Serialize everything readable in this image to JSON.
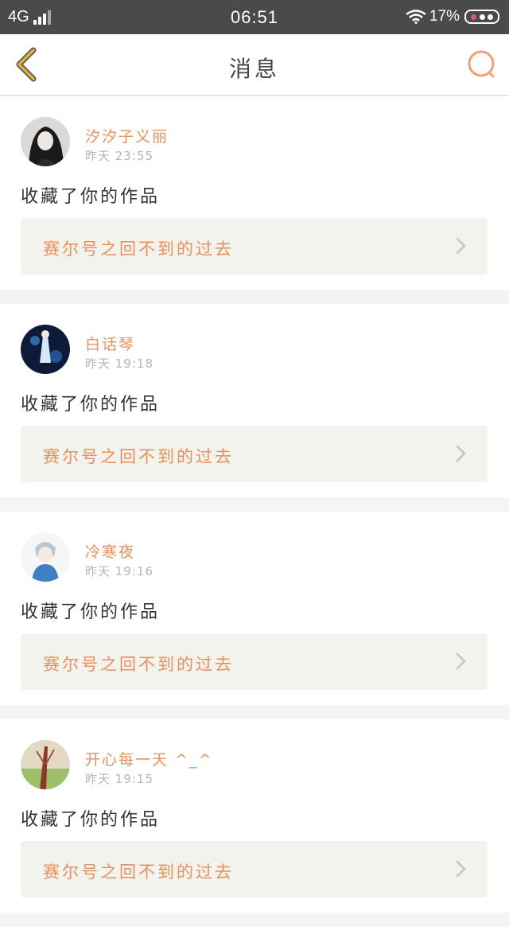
{
  "status_bar": {
    "network": "4G",
    "time": "06:51",
    "battery": "17%"
  },
  "header": {
    "title": "消息"
  },
  "colors": {
    "accent": "#e8905a",
    "back_arrow": "#e0b23a",
    "search_icon": "#f0a070"
  },
  "messages": [
    {
      "username": "汐汐子义丽",
      "time": "昨天 23:55",
      "action": "收藏了你的作品",
      "work_title": "赛尔号之回不到的过去"
    },
    {
      "username": "白话琴",
      "time": "昨天 19:18",
      "action": "收藏了你的作品",
      "work_title": "赛尔号之回不到的过去"
    },
    {
      "username": "冷寒夜",
      "time": "昨天 19:16",
      "action": "收藏了你的作品",
      "work_title": "赛尔号之回不到的过去"
    },
    {
      "username": "开心每一天 ^_^",
      "time": "昨天 19:15",
      "action": "收藏了你的作品",
      "work_title": "赛尔号之回不到的过去"
    }
  ]
}
